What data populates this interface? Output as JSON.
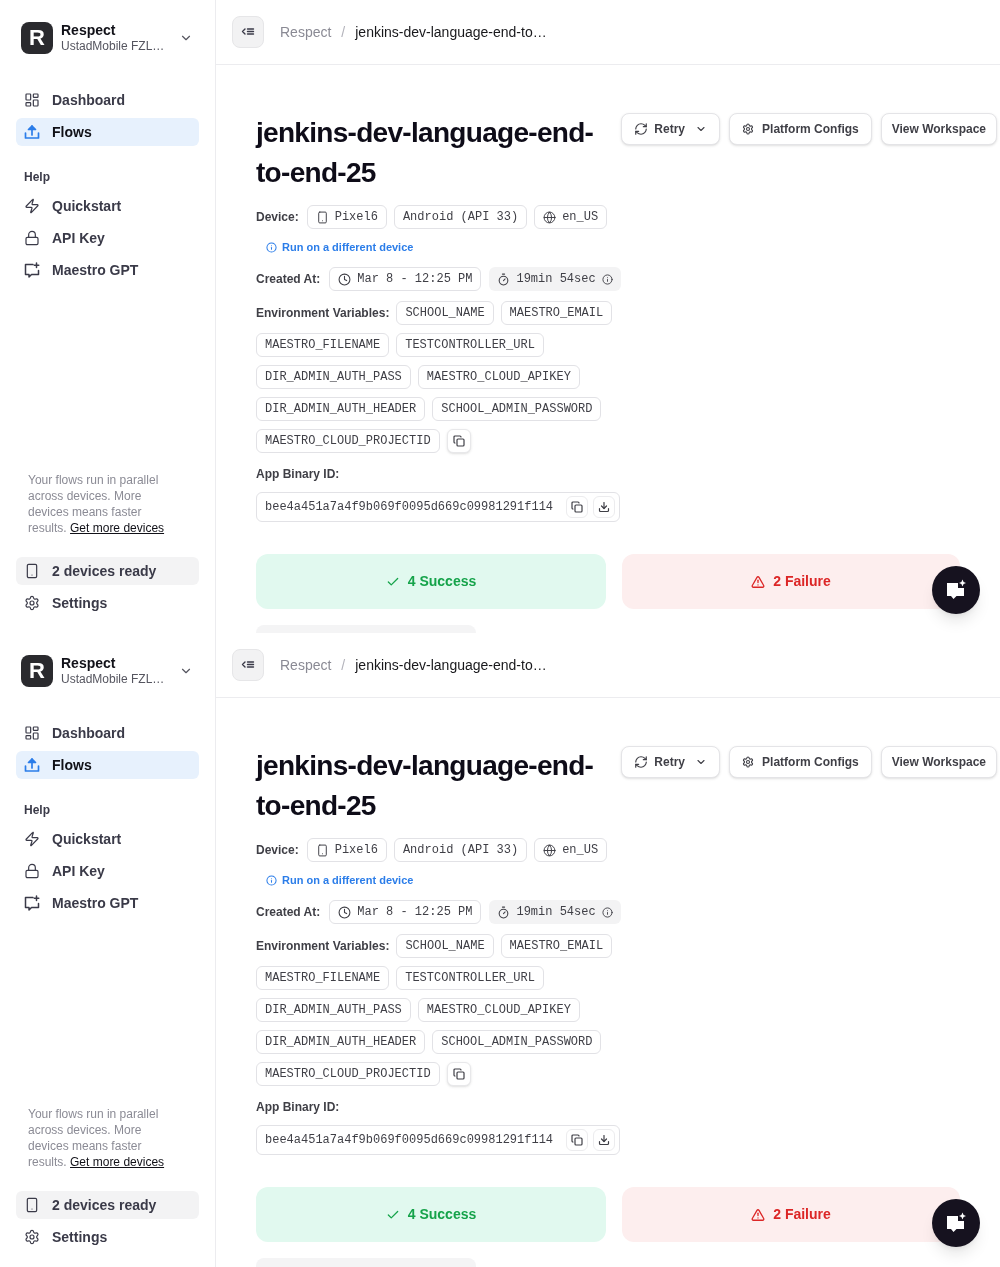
{
  "screens": [
    {
      "sidebar": {
        "org": {
          "logo_text": "R",
          "name": "Respect",
          "subtitle": "UstadMobile FZL…"
        },
        "nav": [
          {
            "label": "Dashboard",
            "selected": false
          },
          {
            "label": "Flows",
            "selected": true
          }
        ],
        "help": {
          "heading": "Help",
          "items": [
            {
              "label": "Quickstart",
              "selected": false
            },
            {
              "label": "API Key",
              "selected": false
            },
            {
              "label": "Maestro GPT",
              "selected": false
            }
          ]
        },
        "promo": {
          "text": "Your flows run in parallel across devices. More devices means faster results.",
          "link": "Get more devices"
        },
        "devices_status": "2 devices ready",
        "settings": "Settings"
      },
      "header": {
        "breadcrumb": [
          "Respect",
          "jenkins-dev-language-end-to…"
        ],
        "separator": "/"
      },
      "flow": {
        "title": "jenkins-dev-language-end-to-end-25",
        "actions": {
          "retry": "Retry",
          "platform_configs": "Platform Configs",
          "view_workspace": "View Workspace"
        },
        "device": {
          "label": "Device:",
          "model": "Pixel6",
          "os": "Android (API 33)",
          "locale": "en_US",
          "run_link": "Run on a different device"
        },
        "created": {
          "label": "Created At:",
          "date": "Mar 8 - 12:25 PM",
          "duration": "19min 54sec"
        },
        "env": {
          "label": "Environment Variables:",
          "vars": [
            "SCHOOL_NAME",
            "MAESTRO_EMAIL",
            "MAESTRO_FILENAME",
            "TESTCONTROLLER_URL",
            "DIR_ADMIN_AUTH_PASS",
            "MAESTRO_CLOUD_APIKEY",
            "DIR_ADMIN_AUTH_HEADER",
            "SCHOOL_ADMIN_PASSWORD",
            "MAESTRO_CLOUD_PROJECTID"
          ]
        },
        "binary": {
          "label": "App Binary ID:",
          "value": "bee4a451a7a4f9b069f0095d669c09981291f114"
        },
        "results": [
          {
            "kind": "success",
            "label": "4 Success"
          },
          {
            "kind": "failure",
            "label": "2 Failure"
          }
        ]
      }
    },
    {
      "sidebar": {
        "org": {
          "logo_text": "R",
          "name": "Respect",
          "subtitle": "UstadMobile FZL…"
        },
        "nav": [
          {
            "label": "Dashboard",
            "selected": false
          },
          {
            "label": "Flows",
            "selected": true
          }
        ],
        "help": {
          "heading": "Help",
          "items": [
            {
              "label": "Quickstart",
              "selected": false
            },
            {
              "label": "API Key",
              "selected": false
            },
            {
              "label": "Maestro GPT",
              "selected": false
            }
          ]
        },
        "promo": {
          "text": "Your flows run in parallel across devices. More devices means faster results.",
          "link": "Get more devices"
        },
        "devices_status": "2 devices ready",
        "settings": "Settings"
      },
      "header": {
        "breadcrumb": [
          "Respect",
          "jenkins-dev-language-end-to…"
        ],
        "separator": "/"
      },
      "flow": {
        "title": "jenkins-dev-language-end-to-end-25",
        "actions": {
          "retry": "Retry",
          "platform_configs": "Platform Configs",
          "view_workspace": "View Workspace"
        },
        "device": {
          "label": "Device:",
          "model": "Pixel6",
          "os": "Android (API 33)",
          "locale": "en_US",
          "run_link": "Run on a different device"
        },
        "created": {
          "label": "Created At:",
          "date": "Mar 8 - 12:25 PM",
          "duration": "19min 54sec"
        },
        "env": {
          "label": "Environment Variables:",
          "vars": [
            "SCHOOL_NAME",
            "MAESTRO_EMAIL",
            "MAESTRO_FILENAME",
            "TESTCONTROLLER_URL",
            "DIR_ADMIN_AUTH_PASS",
            "MAESTRO_CLOUD_APIKEY",
            "DIR_ADMIN_AUTH_HEADER",
            "SCHOOL_ADMIN_PASSWORD",
            "MAESTRO_CLOUD_PROJECTID"
          ]
        },
        "binary": {
          "label": "App Binary ID:",
          "value": "bee4a451a7a4f9b069f0095d669c09981291f114"
        },
        "results": [
          {
            "kind": "success",
            "label": "4 Success"
          },
          {
            "kind": "failure",
            "label": "2 Failure"
          }
        ]
      }
    }
  ]
}
